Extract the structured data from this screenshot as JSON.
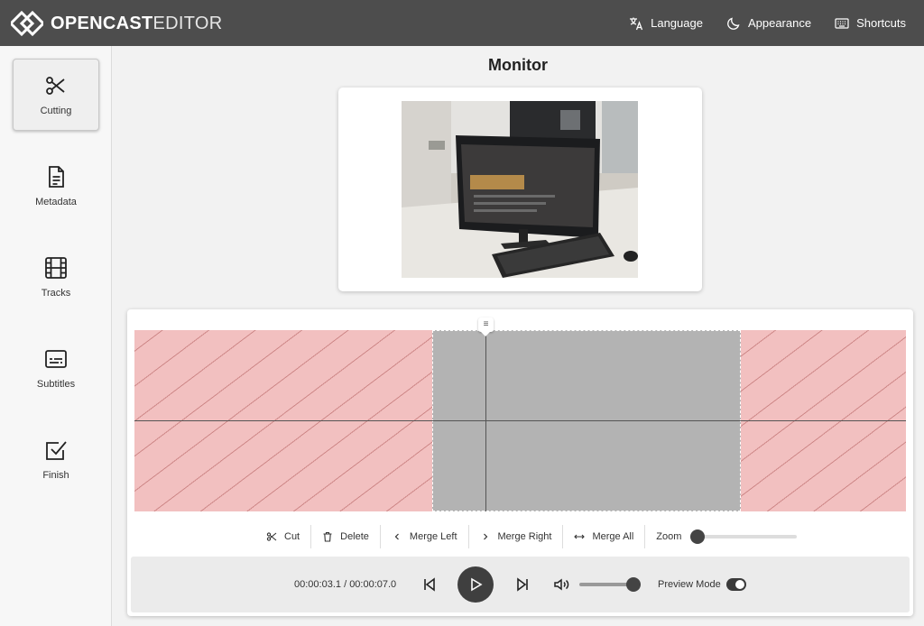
{
  "header": {
    "logo_bold": "OPENCAST",
    "logo_light": "EDITOR",
    "nav": [
      {
        "label": "Language",
        "icon": "translate-icon"
      },
      {
        "label": "Appearance",
        "icon": "moon-icon"
      },
      {
        "label": "Shortcuts",
        "icon": "keyboard-icon"
      }
    ]
  },
  "sidebar": {
    "items": [
      {
        "label": "Cutting",
        "icon": "scissors-icon",
        "active": true
      },
      {
        "label": "Metadata",
        "icon": "document-icon",
        "active": false
      },
      {
        "label": "Tracks",
        "icon": "film-icon",
        "active": false
      },
      {
        "label": "Subtitles",
        "icon": "subtitles-icon",
        "active": false
      },
      {
        "label": "Finish",
        "icon": "checkbox-icon",
        "active": false
      }
    ]
  },
  "main": {
    "title": "Monitor"
  },
  "timeline": {
    "segments": [
      {
        "state": "deleted",
        "start": 0.0,
        "end": 2.7
      },
      {
        "state": "kept",
        "start": 2.7,
        "end": 5.5
      },
      {
        "state": "deleted",
        "start": 5.5,
        "end": 7.0
      }
    ]
  },
  "toolbar": {
    "cut_label": "Cut",
    "delete_label": "Delete",
    "merge_left_label": "Merge Left",
    "merge_right_label": "Merge Right",
    "merge_all_label": "Merge All",
    "zoom_label": "Zoom",
    "zoom_level": 0
  },
  "player": {
    "current_time": "00:00:03.1",
    "separator": "/",
    "duration": "00:00:07.0",
    "volume": 1.0,
    "preview_mode_label": "Preview Mode",
    "preview_mode_on": true
  },
  "colors": {
    "header_bg": "#4d4d4d",
    "deleted_segment": "#f2c0c0",
    "kept_segment": "#b3b3b3"
  }
}
